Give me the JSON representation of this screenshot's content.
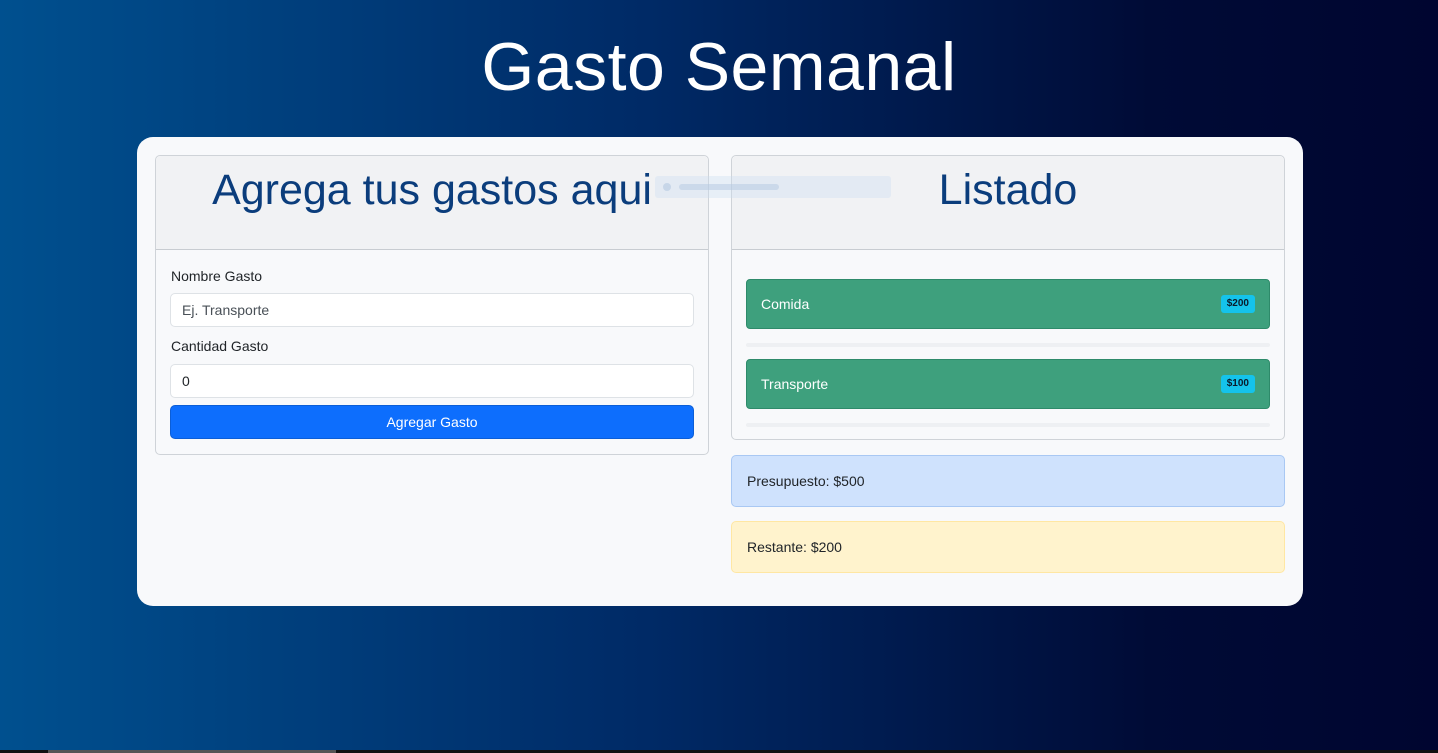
{
  "page": {
    "title": "Gasto Semanal"
  },
  "form_card": {
    "title": "Agrega tus gastos aqui",
    "name_label": "Nombre Gasto",
    "name_placeholder": "Ej. Transporte",
    "name_value": "",
    "amount_label": "Cantidad Gasto",
    "amount_value": "0",
    "submit_label": "Agregar Gasto"
  },
  "list_card": {
    "title": "Listado",
    "items": [
      {
        "name": "Comida",
        "amount": "$200"
      },
      {
        "name": "Transporte",
        "amount": "$100"
      }
    ]
  },
  "summary": {
    "budget": "Presupuesto: $500",
    "remaining": "Restante: $200"
  },
  "colors": {
    "primary": "#0d6efd",
    "item_bg": "#3ea07d",
    "badge": "#14c3eb",
    "heading": "#0b3d7c",
    "info_bg": "#cfe2fd",
    "warning_bg": "#fff3cd"
  }
}
